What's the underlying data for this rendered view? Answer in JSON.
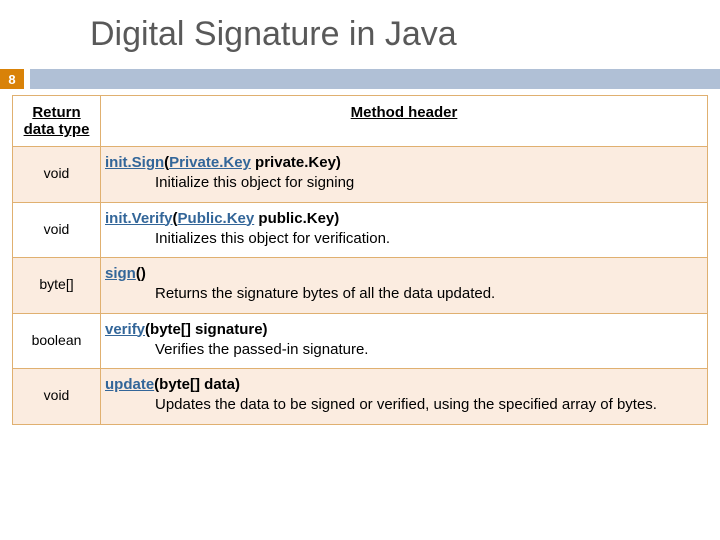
{
  "title": "Digital Signature in Java",
  "page_number": "8",
  "headers": {
    "return": "Return data type",
    "method": " Method header"
  },
  "rows": [
    {
      "stripe": true,
      "return_type": "void",
      "method_link": "init.Sign",
      "param_open": "(",
      "param_link": "Private.Key",
      "param_rest": " private.Key)",
      "desc": "Initialize this object for signing"
    },
    {
      "stripe": false,
      "return_type": "void",
      "method_link": "init.Verify",
      "param_open": "(",
      "param_link": "Public.Key",
      "param_rest": " public.Key)",
      "desc": "Initializes this object for verification."
    },
    {
      "stripe": true,
      "return_type": "byte[]",
      "method_link": "sign",
      "param_open": "()",
      "param_link": "",
      "param_rest": "",
      "desc": "Returns the signature bytes of all the data updated."
    },
    {
      "stripe": false,
      "return_type": "boolean",
      "method_link": "verify",
      "param_open": "",
      "param_link": "",
      "param_rest": "(byte[] signature)",
      "desc": "Verifies the passed-in signature."
    },
    {
      "stripe": true,
      "return_type": "void",
      "method_link": "update",
      "param_open": "",
      "param_link": "",
      "param_rest": "(byte[] data)",
      "desc": "Updates the data to be signed or verified, using the specified array of bytes."
    }
  ]
}
